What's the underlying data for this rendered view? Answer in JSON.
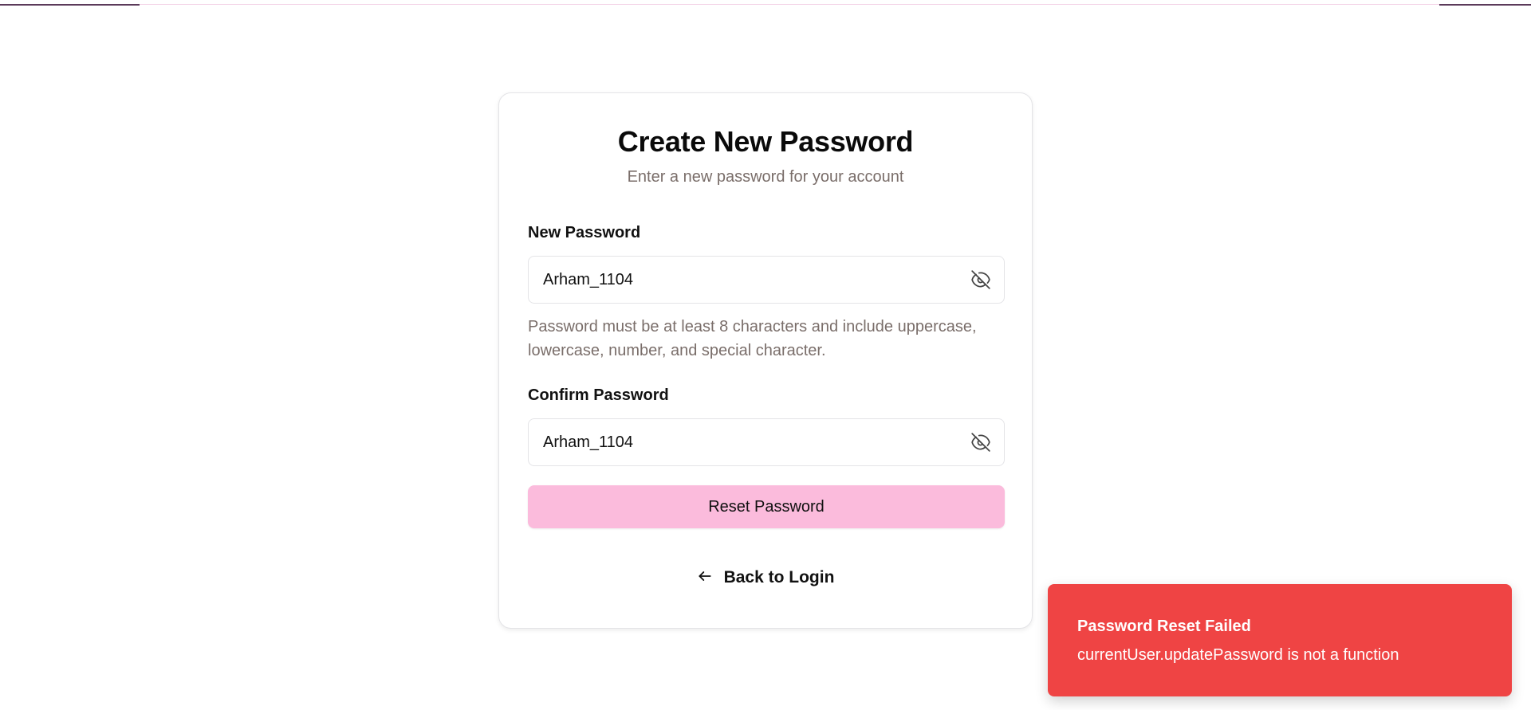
{
  "page": {
    "title": "Create New Password",
    "subtitle": "Enter a new password for your account"
  },
  "form": {
    "new_password": {
      "label": "New Password",
      "value": "Arham_1104",
      "toggle_icon": "eye-off-icon"
    },
    "hint": "Password must be at least 8 characters and include uppercase, lowercase, number, and special character.",
    "confirm_password": {
      "label": "Confirm Password",
      "value": "Arham_1104",
      "toggle_icon": "eye-off-icon"
    },
    "submit_label": "Reset Password",
    "back_label": "Back to Login",
    "back_icon": "arrow-left-icon"
  },
  "toast": {
    "title": "Password Reset Failed",
    "message": "currentUser.updatePassword is not a function"
  },
  "colors": {
    "accent_button": "#fbbbdc",
    "toast_error": "#ef4444",
    "muted_text": "#7a6e6a"
  }
}
